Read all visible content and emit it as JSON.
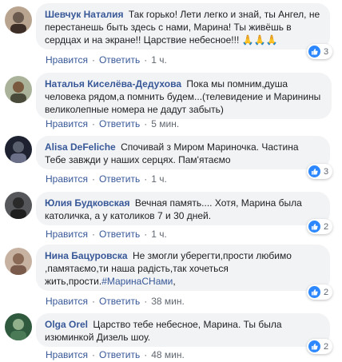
{
  "comments": [
    {
      "author": "Шевчук Наталия",
      "text": "Так горько! Лети легко и знай, ты Ангел, не перестанешь быть здесь с нами, Марина! Ты живёшь в сердцах и на экране!! Царствие небесное!!! 🙏🙏🙏",
      "actions": {
        "like": "Нравится",
        "reply": "Ответить",
        "time": "1 ч."
      },
      "reactions": "3",
      "avatar_color": "#6b5a4e"
    },
    {
      "author": "Наталья Киселёва-Дедухова",
      "text": "Пока мы помним,душа человека рядом,а помнить будем...(телевидение и Маринины великолепные номера не дадут забыть)",
      "actions": {
        "like": "Нравится",
        "reply": "Ответить",
        "time": "5 мин."
      },
      "reactions": "",
      "avatar_color": "#7a8a6a"
    },
    {
      "author": "Alisa DeFeliche",
      "text": "Спочивай з Миром Мариночка. Частина Тебе завжди у наших серцях. Пам'ятаємо",
      "actions": {
        "like": "Нравится",
        "reply": "Ответить",
        "time": "1 ч."
      },
      "reactions": "3",
      "avatar_color": "#2c2f3a"
    },
    {
      "author": "Юлия Будковская",
      "text": "Вечная память.... Хотя, Марина была католичка, а у католиков 7 и 30 дней.",
      "actions": {
        "like": "Нравится",
        "reply": "Ответить",
        "time": "1 ч."
      },
      "reactions": "2",
      "avatar_color": "#3a3a3a"
    },
    {
      "author": "Нина Бацуровска",
      "text": "Не змогли уберегти,прости любимо ,памятаємо,ти наша радість,так хочеться жить,прости.",
      "hashtag": "#МаринаСНами",
      "text_after": ",",
      "actions": {
        "like": "Нравится",
        "reply": "Ответить",
        "time": "38 мин."
      },
      "reactions": "2",
      "avatar_color": "#9a7a66"
    },
    {
      "author": "Olga Orel",
      "text": "Царство тебе небесное, Марина. Ты была изюминкой Дизель шоу.",
      "actions": {
        "like": "Нравится",
        "reply": "Ответить",
        "time": "48 мин."
      },
      "reactions": "2",
      "avatar_color": "#3f6a4a"
    }
  ],
  "separator": "·"
}
